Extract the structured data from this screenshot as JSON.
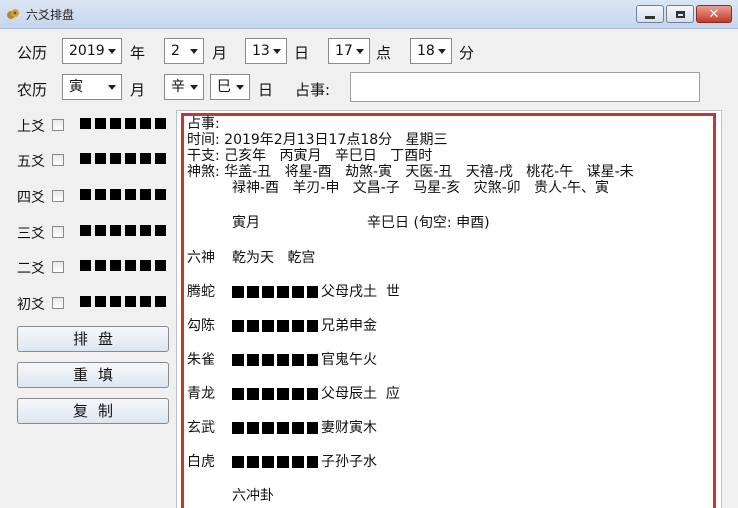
{
  "window": {
    "title": "六爻排盘"
  },
  "solar": {
    "label": "公历",
    "year": "2019",
    "year_unit": "年",
    "month": "2",
    "month_unit": "月",
    "day": "13",
    "day_unit": "日",
    "hour": "17",
    "hour_unit": "点",
    "minute": "18",
    "minute_unit": "分"
  },
  "lunar": {
    "label": "农历",
    "month": "寅",
    "month_unit": "月",
    "day_stem": "辛",
    "day_branch": "巳",
    "day_unit": "日",
    "question_label": "占事:",
    "question_value": ""
  },
  "yao_rows": [
    {
      "label": "上爻"
    },
    {
      "label": "五爻"
    },
    {
      "label": "四爻"
    },
    {
      "label": "三爻"
    },
    {
      "label": "二爻"
    },
    {
      "label": "初爻"
    }
  ],
  "buttons": {
    "arrange": "排盘",
    "reset": "重填",
    "copy": "复制"
  },
  "result": {
    "line1": "占事:",
    "line2": "时间: 2019年2月13日17点18分   星期三",
    "line3": "干支: 己亥年   丙寅月   辛巳日   丁酉时",
    "line4": "神煞: 华盖-丑   将星-酉   劫煞-寅   天医-丑   天禧-戌   桃花-午   谋星-未",
    "line5": "禄神-酉   羊刃-申   文昌-子   马星-亥   灾煞-卯   贵人-午、寅",
    "month_line": "寅月",
    "day_line": "辛巳日 (旬空: 申酉)",
    "gods_label": "六神",
    "hexagram": "乾为天   乾宫",
    "rows": [
      {
        "god": "腾蛇",
        "text": "父母戌土  世"
      },
      {
        "god": "勾陈",
        "text": "兄弟申金"
      },
      {
        "god": "朱雀",
        "text": "官鬼午火"
      },
      {
        "god": "青龙",
        "text": "父母辰土  应"
      },
      {
        "god": "玄武",
        "text": "妻财寅木"
      },
      {
        "god": "白虎",
        "text": "子孙子水"
      }
    ],
    "footer": "六冲卦"
  }
}
